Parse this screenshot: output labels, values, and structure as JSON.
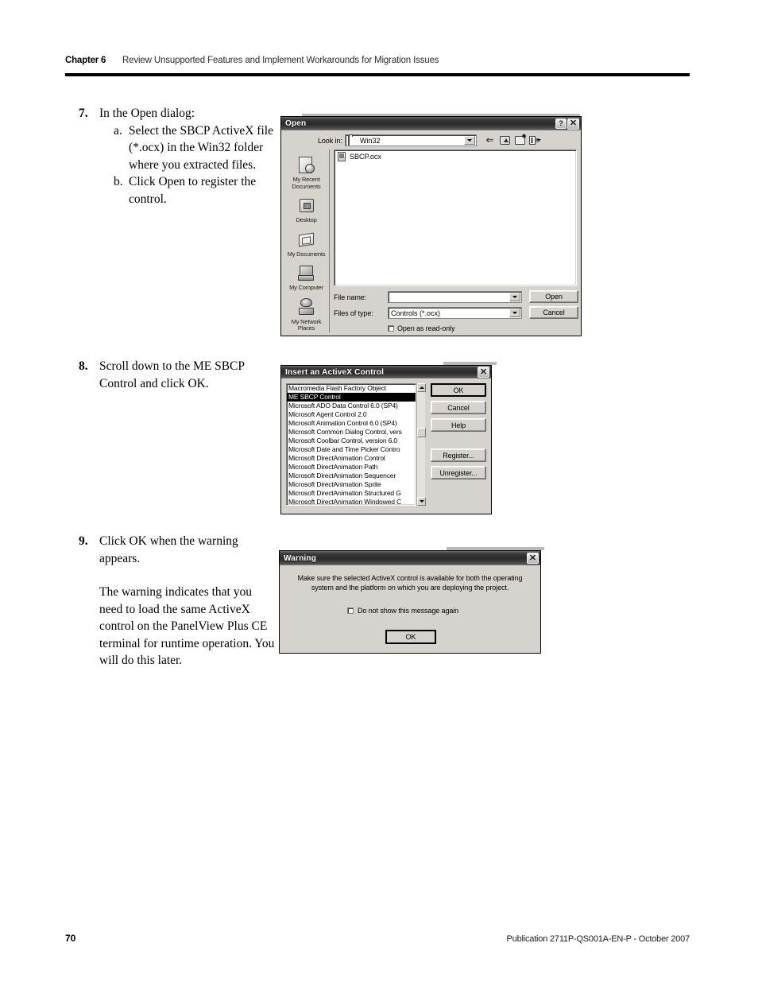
{
  "header": {
    "chapter": "Chapter 6",
    "title": "Review Unsupported Features and Implement Workarounds for Migration Issues"
  },
  "footer": {
    "page_number": "70",
    "publication": "Publication 2711P-QS001A-EN-P - October 2007"
  },
  "steps": [
    {
      "number": "7.",
      "text": "In the Open dialog:",
      "substeps": [
        {
          "marker": "a.",
          "text": "Select the SBCP ActiveX file (*.ocx) in the Win32 folder where you extracted files."
        },
        {
          "marker": "b.",
          "text": "Click Open to register the control."
        }
      ]
    },
    {
      "number": "8.",
      "text": "Scroll down to the ME SBCP Control and click OK."
    },
    {
      "number": "9.",
      "text": "Click OK when the warning appears.",
      "paragraph": "The warning indicates that you need to load the same ActiveX control on the PanelView Plus CE terminal for runtime operation. You will do this later."
    }
  ],
  "open_dialog": {
    "title": "Open",
    "help_button": "?",
    "close_button": "✕",
    "lookin_label": "Look in:",
    "lookin_value": "Win32",
    "toolbar": [
      "back-icon",
      "up-one-level-icon",
      "new-folder-icon",
      "views-icon"
    ],
    "places": [
      {
        "label_line1": "My Recent",
        "label_line2": "Documents",
        "icon": "recent-documents-icon"
      },
      {
        "label_line1": "Desktop",
        "label_line2": "",
        "icon": "desktop-icon"
      },
      {
        "label_line1": "My Documents",
        "label_line2": "",
        "icon": "my-documents-icon"
      },
      {
        "label_line1": "My Computer",
        "label_line2": "",
        "icon": "my-computer-icon"
      },
      {
        "label_line1": "My Network",
        "label_line2": "Places",
        "icon": "my-network-places-icon"
      }
    ],
    "files": [
      {
        "name": "SBCP.ocx",
        "icon": "ocx-file-icon"
      }
    ],
    "filename_label": "File name:",
    "filename_value": "",
    "filetype_label": "Files of type:",
    "filetype_value": "Controls (*.ocx)",
    "readonly_label": "Open as read-only",
    "readonly_checked": false,
    "open_button": "Open",
    "cancel_button": "Cancel"
  },
  "insert_dialog": {
    "title": "Insert an ActiveX Control",
    "close_button": "✕",
    "controls": [
      "Macromedia Flash Factory Object",
      "ME SBCP Control",
      "Microsoft ADO Data Control 6.0 (SP4)",
      "Microsoft Agent Control 2.0",
      "Microsoft Animation Control 6.0 (SP4)",
      "Microsoft Common Dialog Control, vers",
      "Microsoft Coolbar Control, version 6.0",
      "Microsoft Date and Time Picker Contro",
      "Microsoft DirectAnimation Control",
      "Microsoft DirectAnimation Path",
      "Microsoft DirectAnimation Sequencer",
      "Microsoft DirectAnimation Sprite",
      "Microsoft DirectAnimation Structured G",
      "Microsoft DirectAnimation Windowed C"
    ],
    "selected_control": "ME SBCP Control",
    "ok_button": "OK",
    "cancel_button": "Cancel",
    "help_button": "Help",
    "register_button": "Register...",
    "unregister_button": "Unregister..."
  },
  "warning_dialog": {
    "title": "Warning",
    "close_button": "✕",
    "message_line1": "Make sure the selected ActiveX control is available for both the operating",
    "message_line2": "system and the platform on which you are deploying the project.",
    "dontshow_label": "Do not show this message again",
    "dontshow_checked": false,
    "ok_button": "OK"
  }
}
